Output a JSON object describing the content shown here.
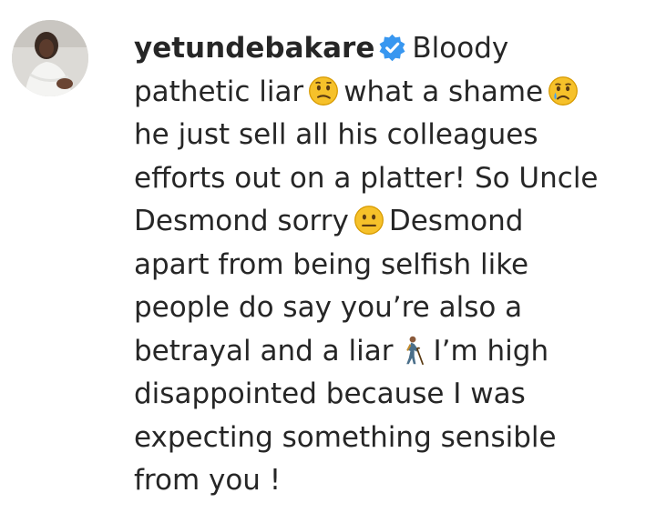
{
  "comment": {
    "username": "yetundebakare",
    "lines": [
      "Bloody",
      "pathetic liar",
      "what a shame",
      "he just sell all his colleagues",
      "efforts out on a platter! So Uncle",
      "Desmond sorry",
      "Desmond",
      "apart from being selfish like",
      "people do say you’re also a",
      "betrayal and a liar",
      "I’m high",
      "disappointed because I was",
      "expecting something sensible",
      "from you !"
    ],
    "icons": {
      "verified": "verified-badge-icon",
      "emoji_1": "confused-face-emoji",
      "emoji_2": "sad-tear-face-emoji",
      "emoji_3": "neutral-face-emoji",
      "emoji_4": "person-with-cane-emoji"
    }
  },
  "colors": {
    "text": "#262626",
    "verified_blue": "#3897f0",
    "emoji_yellow": "#f6c12a"
  }
}
